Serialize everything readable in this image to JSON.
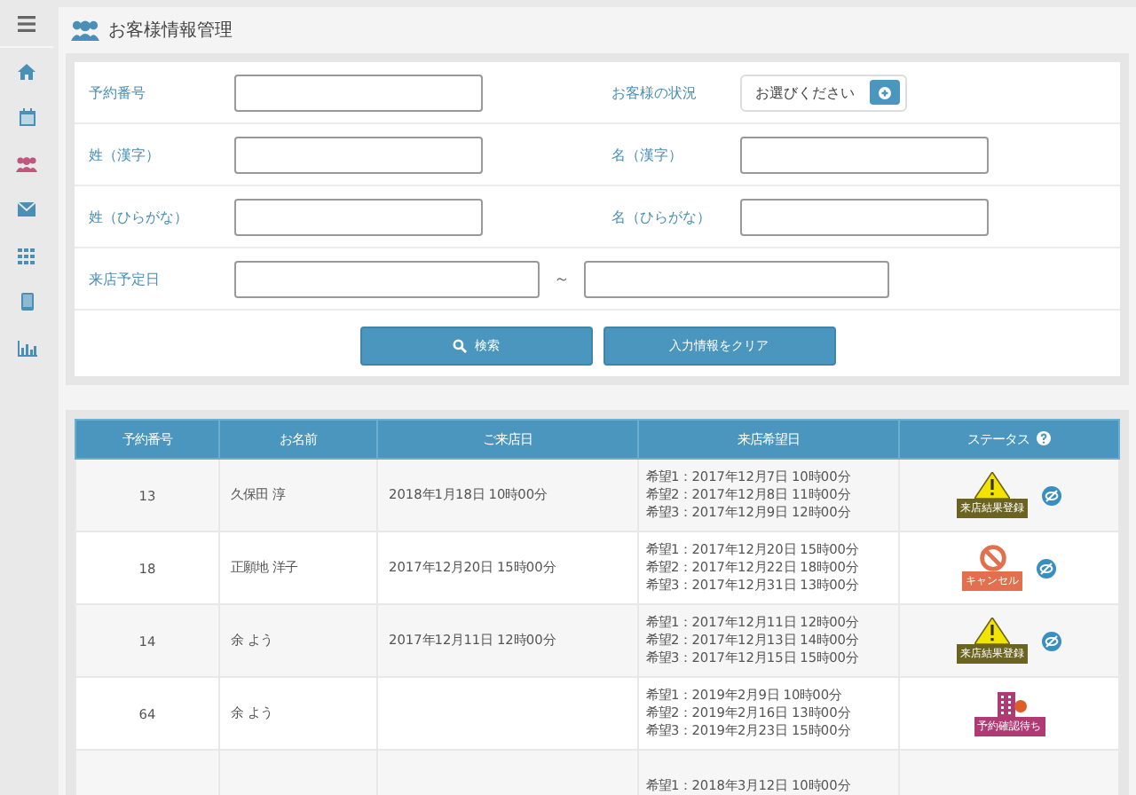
{
  "page_title": "お客様情報管理",
  "form": {
    "rows": [
      {
        "fields": [
          {
            "label": "予約番号",
            "kind": "text"
          },
          {
            "label": "お客様の状況",
            "kind": "select",
            "value": "お選びください"
          }
        ]
      },
      {
        "fields": [
          {
            "label": "姓（漢字）",
            "kind": "text"
          },
          {
            "label": "名（漢字）",
            "kind": "text"
          }
        ]
      },
      {
        "fields": [
          {
            "label": "姓（ひらがな）",
            "kind": "text"
          },
          {
            "label": "名（ひらがな）",
            "kind": "text"
          }
        ]
      },
      {
        "fields": [
          {
            "label": "来店予定日",
            "kind": "range",
            "separator": "～"
          }
        ]
      }
    ],
    "buttons": [
      {
        "label": "検索",
        "kind": "search"
      },
      {
        "label": "入力情報をクリア",
        "kind": "plain"
      }
    ]
  },
  "table": {
    "columns": [
      "予約番号",
      "お名前",
      "ご来店日",
      "来店希望日",
      "ステータス"
    ],
    "rows": [
      {
        "number": "13",
        "name": "久保田 淳",
        "visit": "2018年1月18日 10時00分",
        "wishes": [
          "希望1：2017年12月7日 10時00分",
          "希望2：2017年12月8日 11時00分",
          "希望3：2017年12月9日 12時00分"
        ],
        "status": {
          "kind": "result",
          "label": "来店結果登録"
        },
        "hide_button": true
      },
      {
        "number": "18",
        "name": "正願地 洋子",
        "visit": "2017年12月20日 15時00分",
        "wishes": [
          "希望1：2017年12月20日 15時00分",
          "希望2：2017年12月22日 18時00分",
          "希望3：2017年12月31日 13時00分"
        ],
        "status": {
          "kind": "cancel",
          "label": "キャンセル"
        },
        "hide_button": true
      },
      {
        "number": "14",
        "name": "余 よう",
        "visit": "2017年12月11日 12時00分",
        "wishes": [
          "希望1：2017年12月11日 12時00分",
          "希望2：2017年12月13日 14時00分",
          "希望3：2017年12月15日 15時00分"
        ],
        "status": {
          "kind": "result",
          "label": "来店結果登録"
        },
        "hide_button": true
      },
      {
        "number": "64",
        "name": "余 よう",
        "visit": "",
        "wishes": [
          "希望1：2019年2月9日 10時00分",
          "希望2：2019年2月16日 13時00分",
          "希望3：2019年2月23日 15時00分"
        ],
        "status": {
          "kind": "pending",
          "label": "予約確認待ち"
        },
        "hide_button": false
      },
      {
        "number": "",
        "name": "",
        "visit": "",
        "wishes": [
          "希望1：2018年3月12日 10時00分"
        ],
        "hide_button": false
      }
    ]
  }
}
